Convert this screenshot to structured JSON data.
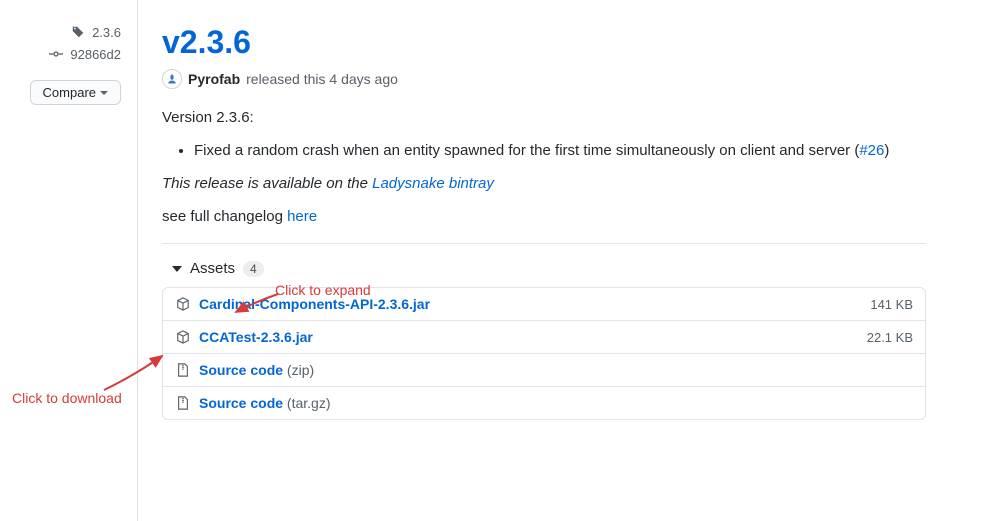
{
  "sidebar": {
    "tag": "2.3.6",
    "commit": "92866d2",
    "compare_label": "Compare"
  },
  "release": {
    "title": "v2.3.6",
    "author": "Pyrofab",
    "released_text": "released this 4 days ago",
    "version_heading": "Version 2.3.6:",
    "changes": [
      "Fixed a random crash when an entity spawned for the first time simultaneously on client and server ("
    ],
    "issue_ref": "#26",
    "avail_prefix": "This release is available on the ",
    "avail_link": "Ladysnake bintray",
    "changelog_prefix": "see full changelog ",
    "changelog_link": "here"
  },
  "assets": {
    "label": "Assets",
    "count": "4",
    "items": [
      {
        "name": "Cardinal-Components-API-2.3.6.jar",
        "size": "141 KB",
        "icon": "package"
      },
      {
        "name": "CCATest-2.3.6.jar",
        "size": "22.1 KB",
        "icon": "package"
      },
      {
        "name": "Source code",
        "fmt": "(zip)",
        "size": "",
        "icon": "zip"
      },
      {
        "name": "Source code",
        "fmt": "(tar.gz)",
        "size": "",
        "icon": "zip"
      }
    ]
  },
  "annotations": {
    "expand": "Click to expand",
    "download": "Click to download"
  }
}
